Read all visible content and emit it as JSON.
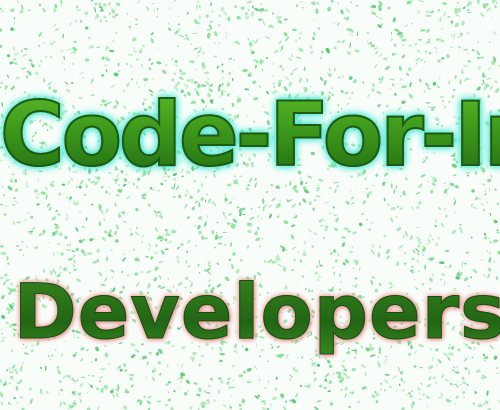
{
  "image": {
    "heading": "Code-For-Iraq",
    "subheading": "Developers",
    "colors": {
      "background": "#f9fdf9",
      "speckle": "#7fe08f",
      "speckle_dark": "#4cc26a",
      "heading_fill": "#3f9f1f",
      "heading_glow": "#4fd6c8",
      "subheading_fill": "#2b7a1a",
      "subheading_glow": "#e48c8c"
    }
  }
}
